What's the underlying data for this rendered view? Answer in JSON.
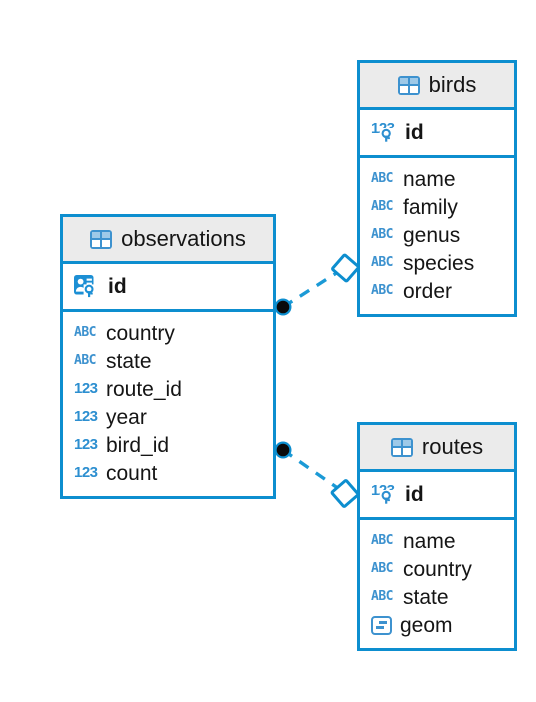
{
  "diagram": {
    "kind": "entity-relationship-diagram",
    "background_color": "#ffffff",
    "accent_color": "#0d8ecf",
    "header_background_color": "#ebebeb",
    "icon_color": "#3d92cf",
    "text_color": "#151515"
  },
  "entities": [
    {
      "id": "observations",
      "name": "observations",
      "header_icon": "table-icon",
      "primary_keys": [
        {
          "name": "id",
          "type_icon": "record-key-icon",
          "type": "identity"
        }
      ],
      "fields": [
        {
          "name": "country",
          "type_icon": "abc-icon",
          "type": "ABC"
        },
        {
          "name": "state",
          "type_icon": "abc-icon",
          "type": "ABC"
        },
        {
          "name": "route_id",
          "type_icon": "123-icon",
          "type": "123"
        },
        {
          "name": "year",
          "type_icon": "123-icon",
          "type": "123"
        },
        {
          "name": "bird_id",
          "type_icon": "123-icon",
          "type": "123"
        },
        {
          "name": "count",
          "type_icon": "123-icon",
          "type": "123"
        }
      ]
    },
    {
      "id": "birds",
      "name": "birds",
      "header_icon": "table-icon",
      "primary_keys": [
        {
          "name": "id",
          "type_icon": "123-key-icon",
          "type": "123"
        }
      ],
      "fields": [
        {
          "name": "name",
          "type_icon": "abc-icon",
          "type": "ABC"
        },
        {
          "name": "family",
          "type_icon": "abc-icon",
          "type": "ABC"
        },
        {
          "name": "genus",
          "type_icon": "abc-icon",
          "type": "ABC"
        },
        {
          "name": "species",
          "type_icon": "abc-icon",
          "type": "ABC"
        },
        {
          "name": "order",
          "type_icon": "abc-icon",
          "type": "ABC"
        }
      ]
    },
    {
      "id": "routes",
      "name": "routes",
      "header_icon": "table-icon",
      "primary_keys": [
        {
          "name": "id",
          "type_icon": "123-key-icon",
          "type": "123"
        }
      ],
      "fields": [
        {
          "name": "name",
          "type_icon": "abc-icon",
          "type": "ABC"
        },
        {
          "name": "country",
          "type_icon": "abc-icon",
          "type": "ABC"
        },
        {
          "name": "state",
          "type_icon": "abc-icon",
          "type": "ABC"
        },
        {
          "name": "geom",
          "type_icon": "blob-icon",
          "type": "blob"
        }
      ]
    }
  ],
  "relationships": [
    {
      "id": "observations-birds",
      "from": "observations",
      "to": "birds",
      "from_marker": "filled-circle",
      "to_marker": "open-diamond",
      "line_style": "dashed",
      "line_color": "#0d8ecf"
    },
    {
      "id": "observations-routes",
      "from": "observations",
      "to": "routes",
      "from_marker": "filled-circle",
      "to_marker": "open-diamond",
      "line_style": "dashed",
      "line_color": "#0d8ecf"
    }
  ]
}
